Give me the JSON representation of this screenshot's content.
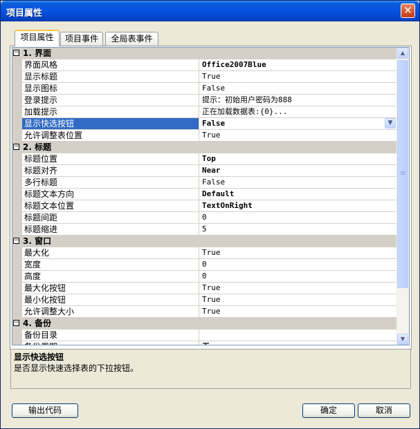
{
  "window": {
    "title": "项目属性"
  },
  "tabs": [
    {
      "label": "项目属性"
    },
    {
      "label": "项目事件"
    },
    {
      "label": "全局表事件"
    }
  ],
  "grid": {
    "categories": [
      {
        "name": "1. 界面",
        "toggle": "−",
        "props": [
          {
            "name": "界面风格",
            "value": "Office2007Blue",
            "bold": true
          },
          {
            "name": "显示标题",
            "value": "True"
          },
          {
            "name": "显示图标",
            "value": "False"
          },
          {
            "name": "登录提示",
            "value": "提示：初始用户密码为888"
          },
          {
            "name": "加载提示",
            "value": "正在加载数据表:{0}..."
          },
          {
            "name": "显示快选按钮",
            "value": "False",
            "bold": true,
            "selected": true,
            "dropdown": true
          },
          {
            "name": "允许调整表位置",
            "value": "True"
          }
        ]
      },
      {
        "name": "2. 标题",
        "toggle": "−",
        "props": [
          {
            "name": "标题位置",
            "value": "Top",
            "bold": true
          },
          {
            "name": "标题对齐",
            "value": "Near",
            "bold": true
          },
          {
            "name": "多行标题",
            "value": "False"
          },
          {
            "name": "标题文本方向",
            "value": "Default",
            "bold": true
          },
          {
            "name": "标题文本位置",
            "value": "TextOnRight",
            "bold": true
          },
          {
            "name": "标题间距",
            "value": "0"
          },
          {
            "name": "标题缩进",
            "value": "5"
          }
        ]
      },
      {
        "name": "3. 窗口",
        "toggle": "−",
        "props": [
          {
            "name": "最大化",
            "value": "True"
          },
          {
            "name": "宽度",
            "value": "0"
          },
          {
            "name": "高度",
            "value": "0"
          },
          {
            "name": "最大化按钮",
            "value": "True"
          },
          {
            "name": "最小化按钮",
            "value": "True"
          },
          {
            "name": "允许调整大小",
            "value": "True"
          }
        ]
      },
      {
        "name": "4. 备份",
        "toggle": "−",
        "props": [
          {
            "name": "备份目录",
            "value": ""
          },
          {
            "name": "备份周期",
            "value": "无",
            "bold": true
          }
        ]
      }
    ]
  },
  "description": {
    "title": "显示快选按钮",
    "text": "是否显示快速选择表的下拉按钮。"
  },
  "buttons": {
    "export": "输出代码",
    "ok": "确定",
    "cancel": "取消"
  }
}
